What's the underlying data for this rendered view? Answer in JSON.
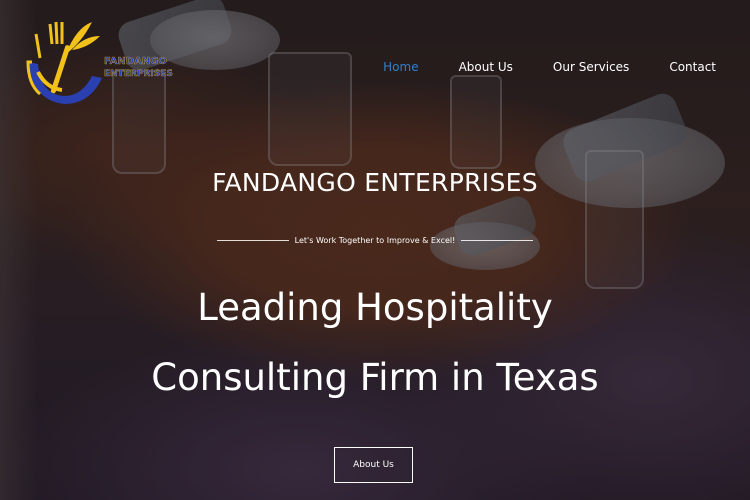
{
  "logo": {
    "text_line1": "FANDANGO",
    "text_line2": "ENTERPRISES",
    "icon": "fork-wheat-bowl-logo"
  },
  "nav": {
    "items": [
      {
        "label": "Home",
        "active": true
      },
      {
        "label": "About Us",
        "active": false
      },
      {
        "label": "Our Services",
        "active": false
      },
      {
        "label": "Contact",
        "active": false
      }
    ]
  },
  "hero": {
    "brand_title": "FANDANGO ENTERPRISES",
    "tagline": "Let's Work Together to Improve & Excel!",
    "headline_line1": "Leading Hospitality",
    "headline_line2": "Consulting Firm in Texas",
    "cta_label": "About Us"
  },
  "colors": {
    "nav_active": "#2f7fd1",
    "text": "#ffffff",
    "logo_blue": "#2a3fb0",
    "logo_gold": "#f2c21b"
  }
}
